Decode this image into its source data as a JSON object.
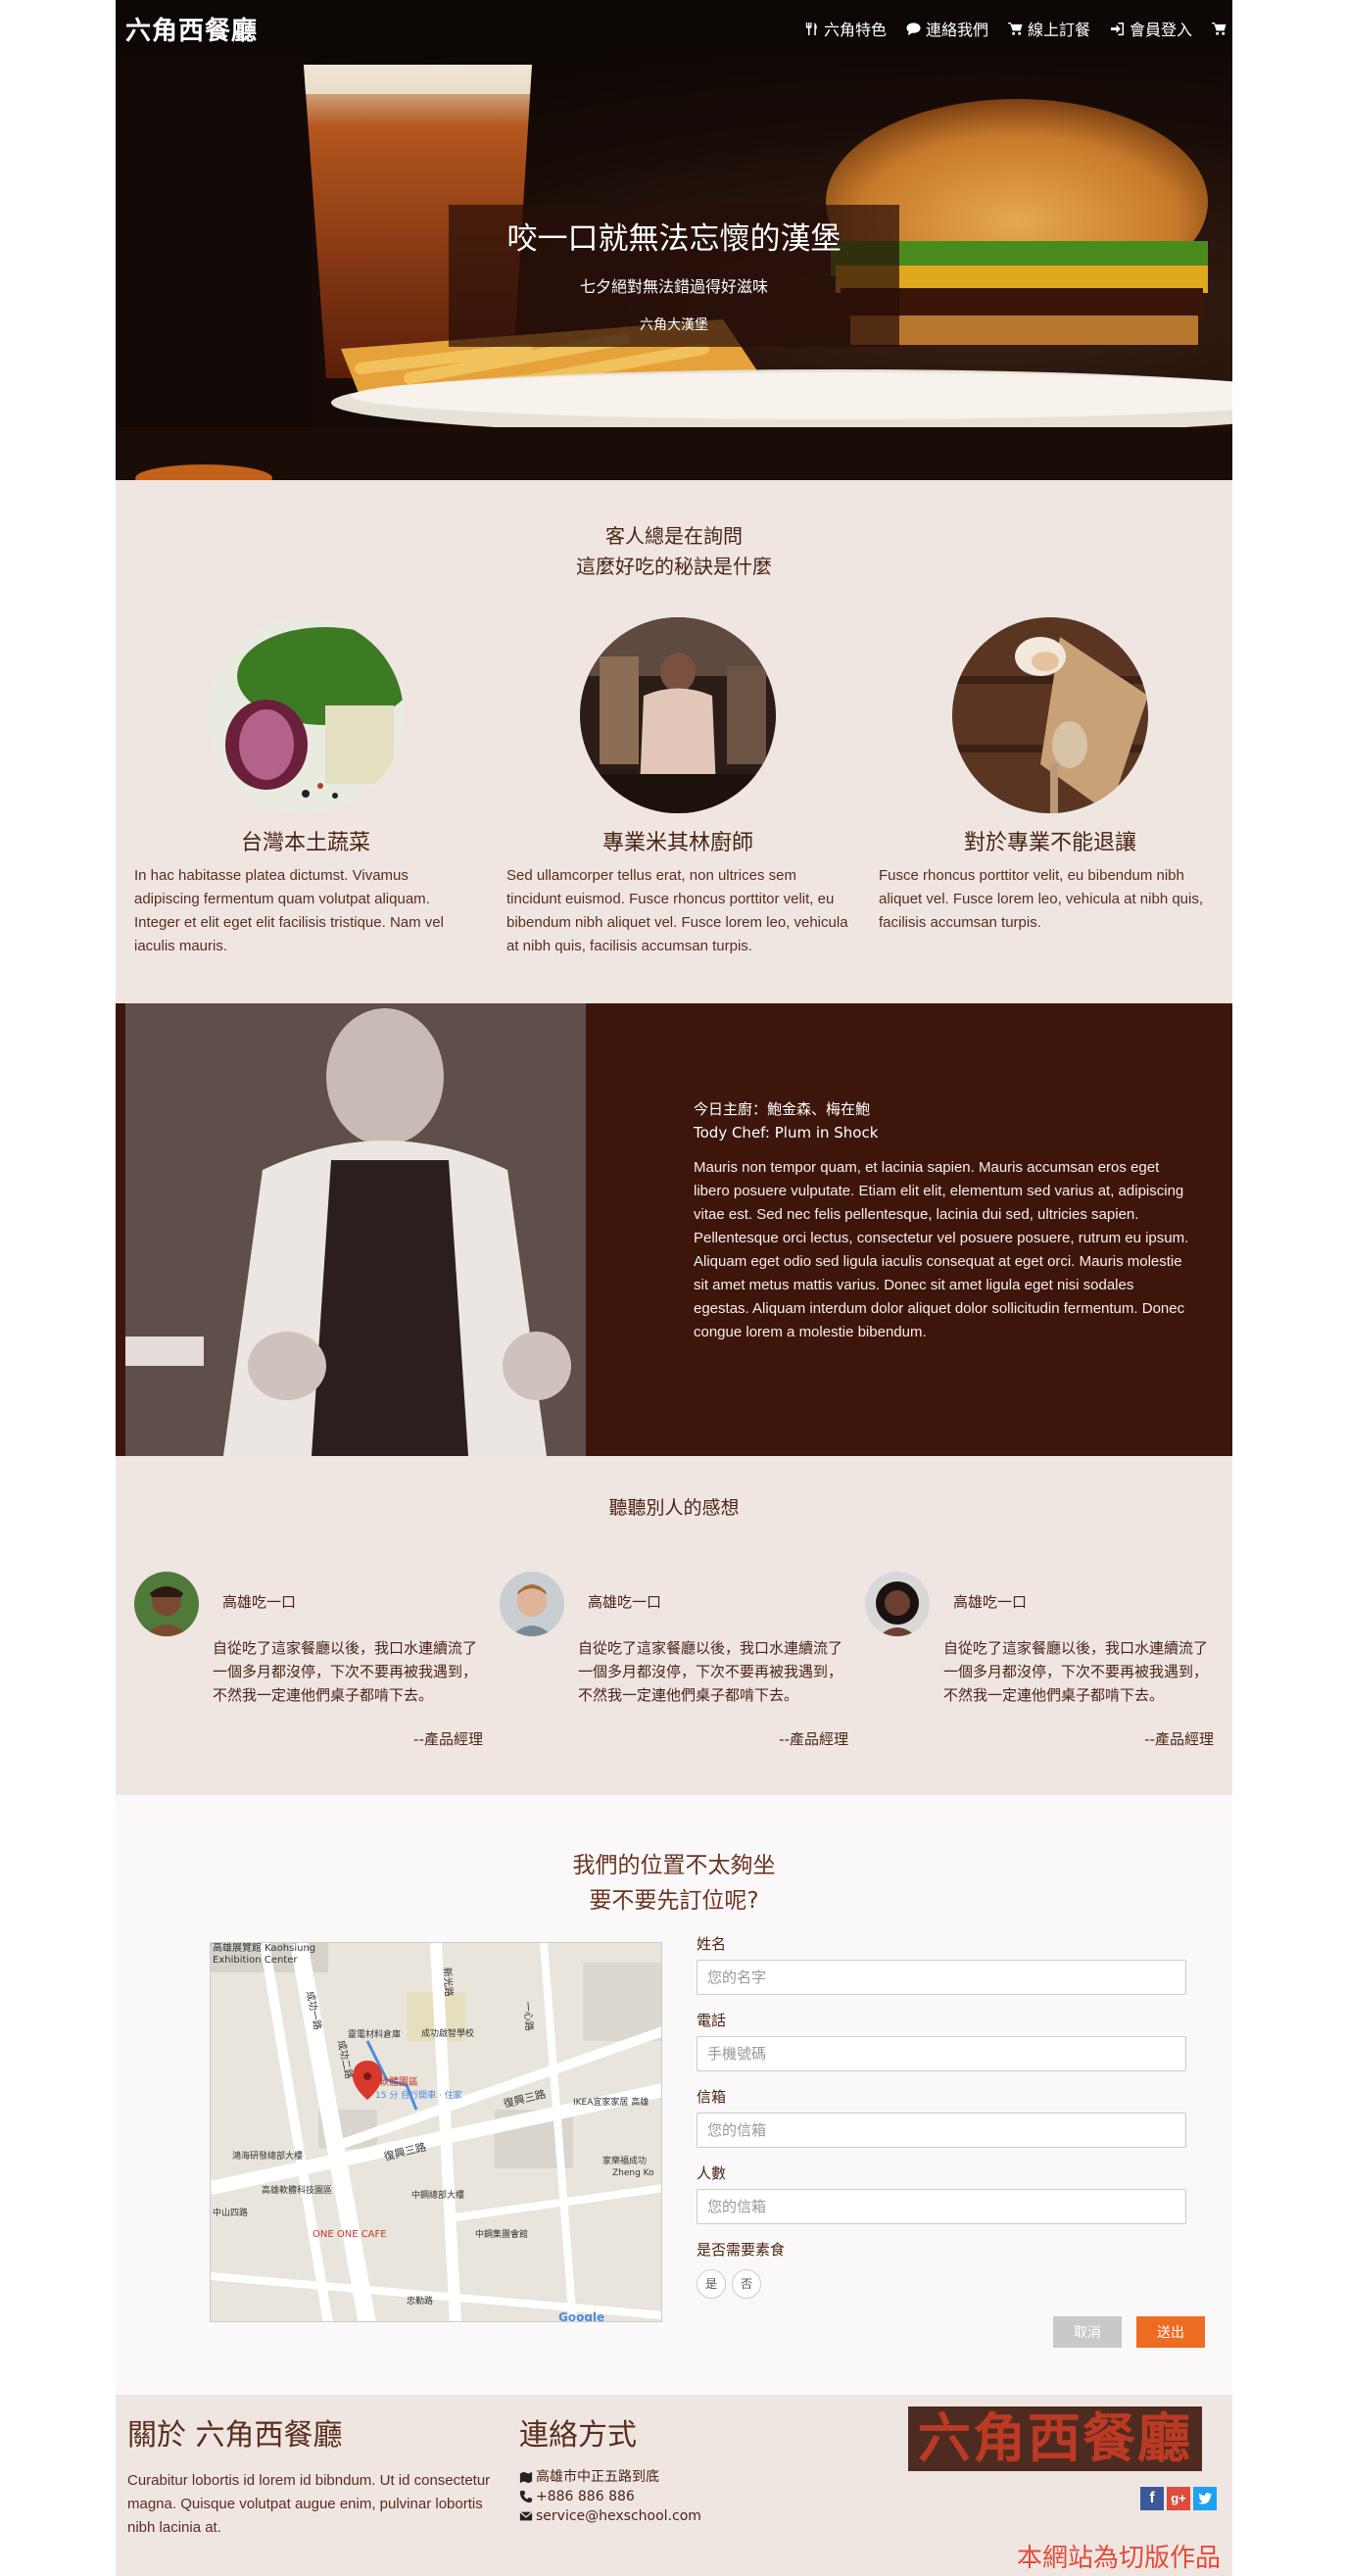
{
  "nav": {
    "brand": "六角西餐廳",
    "links": [
      {
        "icon": "cutlery-icon",
        "label": "六角特色"
      },
      {
        "icon": "comment-icon",
        "label": "連絡我們"
      },
      {
        "icon": "cart-icon",
        "label": "線上訂餐"
      },
      {
        "icon": "login-icon",
        "label": "會員登入"
      }
    ],
    "cart_icon": "cart-icon"
  },
  "hero": {
    "title": "咬一口就無法忘懷的漢堡",
    "subtitle": "七夕絕對無法錯過得好滋味",
    "small": "六角大漢堡"
  },
  "features": {
    "heading_line1": "客人總是在詢問",
    "heading_line2": "這麼好吃的秘訣是什麼",
    "items": [
      {
        "title": "台灣本土蔬菜",
        "text": "In hac habitasse platea dictumst. Vivamus adipiscing fermentum quam volutpat aliquam. Integer et elit eget elit facilisis tristique. Nam vel iaculis mauris."
      },
      {
        "title": "專業米其林廚師",
        "text": "Sed ullamcorper tellus erat, non ultrices sem tincidunt euismod. Fusce rhoncus porttitor velit, eu bibendum nibh aliquet vel. Fusce lorem leo, vehicula at nibh quis, facilisis accumsan turpis."
      },
      {
        "title": "對於專業不能退讓",
        "text": "Fusce rhoncus porttitor velit, eu bibendum nibh aliquet vel. Fusce lorem leo, vehicula at nibh quis, facilisis accumsan turpis."
      }
    ]
  },
  "chef": {
    "line1": "今日主廚：鮑金森、梅在鮑",
    "line2": "Tody Chef: Plum in Shock",
    "text": "Mauris non tempor quam, et lacinia sapien. Mauris accumsan eros eget libero posuere vulputate. Etiam elit elit, elementum sed varius at, adipiscing vitae est. Sed nec felis pellentesque, lacinia dui sed, ultricies sapien. Pellentesque orci lectus, consectetur vel posuere posuere, rutrum eu ipsum. Aliquam eget odio sed ligula iaculis consequat at eget orci. Mauris molestie sit amet metus mattis varius. Donec sit amet ligula eget nisi sodales egestas. Aliquam interdum dolor aliquet dolor sollicitudin fermentum. Donec congue lorem a molestie bibendum."
  },
  "testimonials": {
    "heading": "聽聽別人的感想",
    "items": [
      {
        "name": "高雄吃一口",
        "text": "自從吃了這家餐廳以後，我口水連續流了一個多月都沒停，下次不要再被我遇到，不然我一定連他們桌子都啃下去。",
        "role": "--產品經理"
      },
      {
        "name": "高雄吃一口",
        "text": "自從吃了這家餐廳以後，我口水連續流了一個多月都沒停，下次不要再被我遇到，不然我一定連他們桌子都啃下去。",
        "role": "--產品經理"
      },
      {
        "name": "高雄吃一口",
        "text": "自從吃了這家餐廳以後，我口水連續流了一個多月都沒停，下次不要再被我遇到，不然我一定連他們桌子都啃下去。",
        "role": "--產品經理"
      }
    ]
  },
  "reserve": {
    "heading_line1": "我們的位置不太夠坐",
    "heading_line2": "要不要先訂位呢?",
    "map": {
      "labels": [
        "高雄展覽館 Kaohsiung",
        "Exhibition Center",
        "成功一路",
        "成功二路",
        "新光路",
        "復興三路",
        "復興三路",
        "一心路",
        "靈電材料倉庫",
        "成功啟智學校",
        "軟體園區",
        "15 分 自行開車 · 住家",
        "IKEA宜家家居 高雄",
        "家樂福成功",
        "Zheng Ko",
        "鴻海研發總部大樓",
        "高雄軟體科技園區",
        "中鋼總部大樓",
        "ONE ONE CAFE",
        "中鋼集團會館",
        "中山四路",
        "忠勤路",
        "Google"
      ]
    },
    "form": {
      "name_label": "姓名",
      "name_placeholder": "您的名字",
      "phone_label": "電話",
      "phone_placeholder": "手機號碼",
      "email_label": "信箱",
      "email_placeholder": "您的信箱",
      "people_label": "人數",
      "people_placeholder": "您的信箱",
      "veg_label": "是否需要素食",
      "veg_yes": "是",
      "veg_no": "否",
      "cancel": "取消",
      "submit": "送出"
    }
  },
  "footer": {
    "about_title": "關於 六角西餐廳",
    "about_text": "Curabitur lobortis id lorem id bibndum. Ut id consectetur magna. Quisque volutpat augue enim, pulvinar lobortis nibh lacinia at.",
    "contact_title": "連絡方式",
    "address": "高雄市中正五路到底",
    "phone": "+886 886 886",
    "email": "service@hexschool.com",
    "logo_text": "六角西餐廳",
    "social": [
      "facebook-icon",
      "google-plus-icon",
      "twitter-icon"
    ],
    "note": "本網站為切版作品"
  },
  "colors": {
    "brown": "#3d150b",
    "beige": "#efe6e2",
    "orange": "#ee6b22",
    "red_note": "#e34b3a"
  }
}
